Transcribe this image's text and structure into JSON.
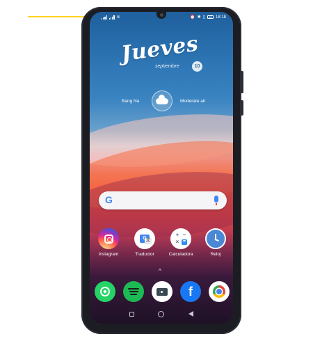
{
  "status_bar": {
    "time": "18:18",
    "network_left_1": "4G",
    "network_left_2": "4G"
  },
  "widget": {
    "day": "Jueves",
    "month": "septiembre",
    "date": "10",
    "location": "Bang Na",
    "condition": "Moderate air"
  },
  "apps": [
    {
      "label": "Instagram",
      "icon": "instagram-icon"
    },
    {
      "label": "Traductor",
      "icon": "translate-icon"
    },
    {
      "label": "Calculadora",
      "icon": "calculator-icon"
    },
    {
      "label": "Reloj",
      "icon": "clock-icon"
    }
  ],
  "dock": [
    {
      "icon": "whatsapp-icon"
    },
    {
      "icon": "spotify-icon"
    },
    {
      "icon": "camera-icon"
    },
    {
      "icon": "facebook-icon"
    },
    {
      "icon": "chrome-icon"
    }
  ],
  "glyphs": {
    "google_g": "G",
    "fb_f": "f",
    "calc_plus": "+",
    "calc_minus": "−",
    "calc_times": "×",
    "calc_eq": "=",
    "chevron_up": "^",
    "translate_g": "G"
  },
  "colors": {
    "annotation_arrow": "#ffd21f",
    "phone_frame": "#1b1d22",
    "accent_blue": "#4285f4"
  }
}
